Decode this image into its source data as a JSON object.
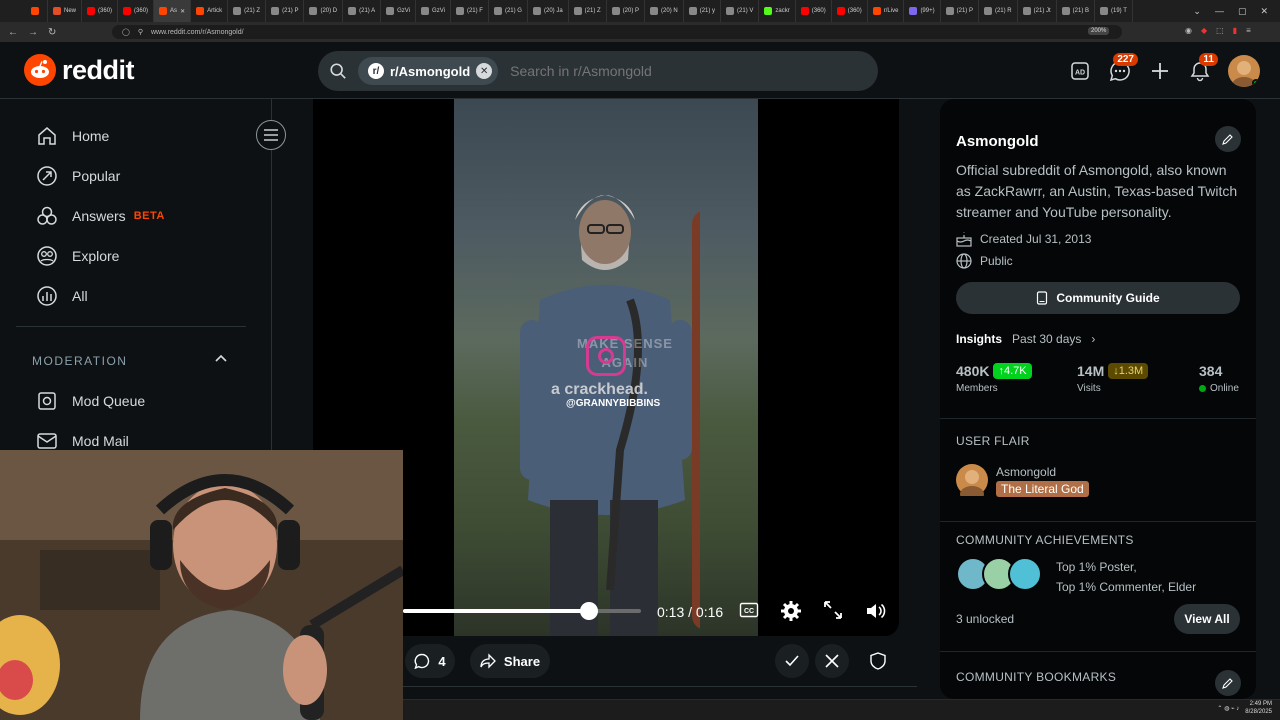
{
  "browser": {
    "tabs": [
      {
        "label": "",
        "color": "#ff4500"
      },
      {
        "label": "New",
        "color": "#e44d26"
      },
      {
        "label": "(360)",
        "color": "#ff0000"
      },
      {
        "label": "(360)",
        "color": "#ff0000"
      },
      {
        "label": "As",
        "color": "#ff4500",
        "active": true
      },
      {
        "label": "Artick",
        "color": "#ff4500"
      },
      {
        "label": "(21) Z",
        "color": "#888888"
      },
      {
        "label": "(21) P",
        "color": "#888888"
      },
      {
        "label": "(20) D",
        "color": "#888888"
      },
      {
        "label": "(21) A",
        "color": "#888888"
      },
      {
        "label": "GzVi",
        "color": "#888888"
      },
      {
        "label": "GzVi",
        "color": "#888888"
      },
      {
        "label": "(21) F",
        "color": "#888888"
      },
      {
        "label": "(21) G",
        "color": "#888888"
      },
      {
        "label": "(20) Ja",
        "color": "#888888"
      },
      {
        "label": "(21) Z",
        "color": "#888888"
      },
      {
        "label": "(20) P",
        "color": "#888888"
      },
      {
        "label": "(20) N",
        "color": "#888888"
      },
      {
        "label": "(21) y",
        "color": "#888888"
      },
      {
        "label": "(21) V",
        "color": "#888888"
      },
      {
        "label": "zackr",
        "color": "#53fc18"
      },
      {
        "label": "(360)",
        "color": "#ff0000"
      },
      {
        "label": "(360)",
        "color": "#ff0000"
      },
      {
        "label": "r/Live",
        "color": "#ff4500"
      },
      {
        "label": "(99+)",
        "color": "#7b68ee"
      },
      {
        "label": "(21) P",
        "color": "#888888"
      },
      {
        "label": "(21) R",
        "color": "#888888"
      },
      {
        "label": "(21) Jt",
        "color": "#888888"
      },
      {
        "label": "(21) B",
        "color": "#888888"
      },
      {
        "label": "(19) T",
        "color": "#888888"
      }
    ],
    "url": "www.reddit.com/r/Asmongold/",
    "zoom": "200%"
  },
  "header": {
    "logo_text": "reddit",
    "search_chip": "r/Asmongold",
    "search_placeholder": "Search in r/Asmongold",
    "chat_badge": "227",
    "notif_badge": "11"
  },
  "sidebar": {
    "items": [
      {
        "label": "Home",
        "icon": "home-icon"
      },
      {
        "label": "Popular",
        "icon": "popular-icon"
      },
      {
        "label": "Answers",
        "icon": "answers-icon",
        "tag": "BETA"
      },
      {
        "label": "Explore",
        "icon": "explore-icon"
      },
      {
        "label": "All",
        "icon": "all-icon"
      }
    ],
    "moderation_heading": "MODERATION",
    "mod_items": [
      {
        "label": "Mod Queue",
        "icon": "mod-queue-icon"
      },
      {
        "label": "Mod Mail",
        "icon": "mod-mail-icon"
      }
    ]
  },
  "video": {
    "overlay_text": "a crackhead.",
    "watermark": "@GRANNYBIBBINS",
    "faded_text": "MAKE SENSE AGAIN",
    "current_time": "0:13",
    "duration": "0:16",
    "progress_fraction": 0.78,
    "time_separator": "/"
  },
  "post_actions": {
    "comment_count": "4",
    "share_label": "Share"
  },
  "community": {
    "name": "Asmongold",
    "description": "Official subreddit of Asmongold, also known as ZackRawrr, an Austin, Texas-based Twitch streamer and YouTube personality.",
    "created": "Created Jul 31, 2013",
    "visibility": "Public",
    "guide_label": "Community Guide",
    "insights_label": "Insights",
    "insights_period": "Past 30 days",
    "stats": [
      {
        "value": "480K",
        "change": "4.7K",
        "direction": "up",
        "label": "Members",
        "color": "#01d21e"
      },
      {
        "value": "14M",
        "change": "1.3M",
        "direction": "down",
        "label": "Visits",
        "color": "#c8a200"
      },
      {
        "value": "384",
        "label": "Online"
      }
    ],
    "user_flair_heading": "USER FLAIR",
    "flair_user": "Asmongold",
    "flair_tag": "The Literal God",
    "achievements_heading": "COMMUNITY ACHIEVEMENTS",
    "achievements_line1": "Top 1% Poster,",
    "achievements_line2": "Top 1% Commenter, Elder",
    "unlocked": "3 unlocked",
    "view_all": "View All",
    "bookmarks_heading": "COMMUNITY BOOKMARKS"
  },
  "taskbar": {
    "time": "2:49 PM",
    "date": "8/28/2025"
  },
  "colors": {
    "brand": "#ff4500",
    "background": "#0e1113",
    "panel": "#050607",
    "up": "#01d21e",
    "down": "#c8a200"
  }
}
